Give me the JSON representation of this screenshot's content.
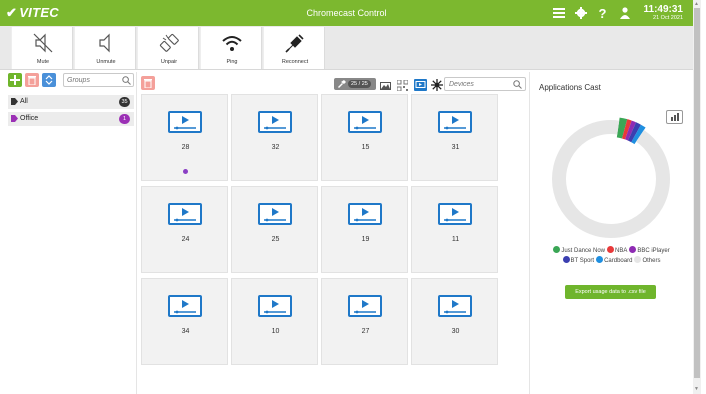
{
  "header": {
    "brand": "VITEC",
    "title": "Chromecast Control",
    "clock_time": "11:49:31",
    "clock_date": "21 Oct 2021",
    "icons": [
      "list-icon",
      "gear-icon",
      "help-icon",
      "user-icon"
    ]
  },
  "toolbar": {
    "buttons": [
      {
        "label": "Mute",
        "icon": "mute-icon"
      },
      {
        "label": "Unmute",
        "icon": "unmute-icon"
      },
      {
        "label": "Unpair",
        "icon": "unpair-icon"
      },
      {
        "label": "Ping",
        "icon": "wifi-icon"
      },
      {
        "label": "Reconnect",
        "icon": "reconnect-icon"
      }
    ]
  },
  "groups": {
    "search_placeholder": "Groups",
    "items": [
      {
        "name": "All",
        "count": "35",
        "tag_color": "#333333"
      },
      {
        "name": "Office",
        "count": "1",
        "tag_color": "#9b30b5"
      }
    ]
  },
  "devices": {
    "count_label": "25 / 25",
    "search_placeholder": "Devices",
    "tiles": [
      {
        "number": "28",
        "has_dot": true
      },
      {
        "number": "32",
        "has_dot": false
      },
      {
        "number": "15",
        "has_dot": false
      },
      {
        "number": "31",
        "has_dot": false
      },
      {
        "number": "24",
        "has_dot": false
      },
      {
        "number": "25",
        "has_dot": false
      },
      {
        "number": "19",
        "has_dot": false
      },
      {
        "number": "11",
        "has_dot": false
      },
      {
        "number": "34",
        "has_dot": false
      },
      {
        "number": "10",
        "has_dot": false
      },
      {
        "number": "27",
        "has_dot": false
      },
      {
        "number": "30",
        "has_dot": false
      }
    ]
  },
  "apps_panel": {
    "title": "Applications Cast",
    "legend_row1": [
      {
        "label": "Just Dance Now",
        "color": "#3aa655"
      },
      {
        "label": "NBA",
        "color": "#e8393a"
      },
      {
        "label": "BBC iPlayer",
        "color": "#8e2bb3"
      }
    ],
    "legend_row2": [
      {
        "label": "BT Sport",
        "color": "#3b3fb0"
      },
      {
        "label": "Cardboard",
        "color": "#1f8fe0"
      },
      {
        "label": "Others",
        "color": "#e6e6e6"
      }
    ],
    "export_label": "Export usage data to .csv file"
  },
  "chart_data": {
    "type": "pie",
    "donut": true,
    "title": "Applications Cast",
    "slices": [
      {
        "label": "Just Dance Now",
        "value": 2,
        "color": "#3aa655"
      },
      {
        "label": "NBA",
        "value": 1.2,
        "color": "#e8393a"
      },
      {
        "label": "BBC iPlayer",
        "value": 1.2,
        "color": "#8e2bb3"
      },
      {
        "label": "BT Sport",
        "value": 1.4,
        "color": "#3b3fb0"
      },
      {
        "label": "Cardboard",
        "value": 1.4,
        "color": "#1f8fe0"
      },
      {
        "label": "Others",
        "value": 92.8,
        "color": "#e6e6e6"
      }
    ]
  }
}
